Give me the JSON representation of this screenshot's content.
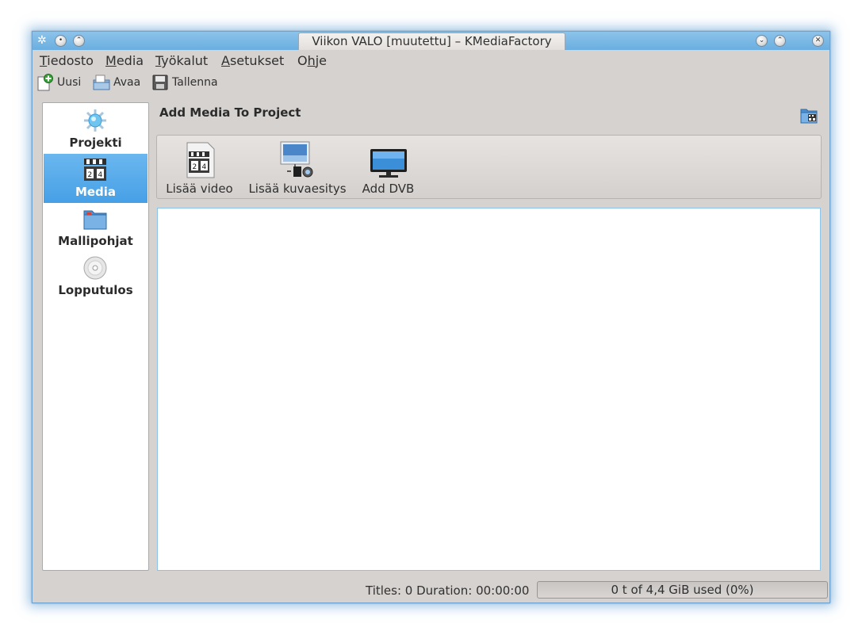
{
  "window": {
    "title": "Viikon VALO [muutettu] – KMediaFactory"
  },
  "menubar": {
    "items": [
      {
        "label": "Tiedosto",
        "accel": "T",
        "rest": "iedosto"
      },
      {
        "label": "Media",
        "accel": "M",
        "rest": "edia"
      },
      {
        "label": "Työkalut",
        "accel": "T",
        "rest": "yökalut"
      },
      {
        "label": "Asetukset",
        "accel": "A",
        "rest": "setukset"
      },
      {
        "label": "Ohje",
        "pre": "O",
        "accel": "h",
        "rest": "je"
      }
    ]
  },
  "toolbar": {
    "new_label": "Uusi",
    "open_label": "Avaa",
    "save_label": "Tallenna"
  },
  "sidebar": {
    "items": [
      {
        "label": "Projekti",
        "icon": "project-icon",
        "active": false
      },
      {
        "label": "Media",
        "icon": "media-clapper-icon",
        "active": true
      },
      {
        "label": "Mallipohjat",
        "icon": "templates-folder-icon",
        "active": false
      },
      {
        "label": "Lopputulos",
        "icon": "disc-icon",
        "active": false
      }
    ]
  },
  "main": {
    "header": "Add Media To Project",
    "actions": [
      {
        "label": "Lisää video",
        "icon": "video-clapper-icon"
      },
      {
        "label": "Lisää kuvaesitys",
        "icon": "slideshow-icon"
      },
      {
        "label": "Add DVB",
        "icon": "tv-icon"
      }
    ]
  },
  "status": {
    "text": "Titles: 0 Duration: 00:00:00",
    "usage_label": "0 t of 4,4 GiB used (0%)",
    "usage_percent": 0
  },
  "colors": {
    "accent": "#46a0e6",
    "window_bg": "#d6d2d0",
    "titlebar": "#6aaee0"
  }
}
